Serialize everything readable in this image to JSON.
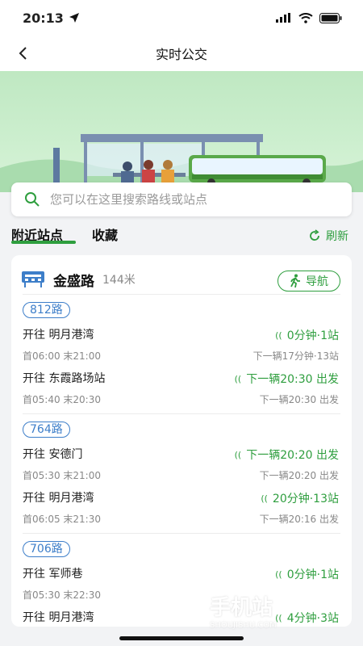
{
  "status": {
    "time": "20:13"
  },
  "nav": {
    "title": "实时公交"
  },
  "search": {
    "placeholder": "您可以在这里搜索路线或站点"
  },
  "tabs": {
    "nearby": "附近站点",
    "favorites": "收藏",
    "refresh": "刷新"
  },
  "station": {
    "name": "金盛路",
    "distance": "144米",
    "navigate": "导航"
  },
  "routes": [
    {
      "name": "812路",
      "directions": [
        {
          "to": "开往 明月港湾",
          "hours": "首06:00 末21:00",
          "arrival": "0分钟·1站",
          "next": "下一辆17分钟·13站"
        },
        {
          "to": "开往 东霞路场站",
          "hours": "首05:40 末20:30",
          "arrival": "下一辆20:30 出发",
          "next": "下一辆20:30 出发"
        }
      ]
    },
    {
      "name": "764路",
      "directions": [
        {
          "to": "开往 安德门",
          "hours": "首05:30 末21:00",
          "arrival": "下一辆20:20 出发",
          "next": "下一辆20:20 出发"
        },
        {
          "to": "开往 明月港湾",
          "hours": "首06:05 末21:30",
          "arrival": "20分钟·13站",
          "next": "下一辆20:16 出发"
        }
      ]
    },
    {
      "name": "706路",
      "directions": [
        {
          "to": "开往 军师巷",
          "hours": "首05:30 末22:30",
          "arrival": "0分钟·1站",
          "next": ""
        },
        {
          "to": "开往 明月港湾",
          "hours": "",
          "arrival": "4分钟·3站",
          "next": ""
        }
      ]
    }
  ],
  "watermark": {
    "text": "手机站",
    "sub": "SHOUJISHU.COM"
  },
  "colors": {
    "accent": "#2e9e3e",
    "route": "#3d7ec9",
    "hero": "#c6ecc9"
  }
}
